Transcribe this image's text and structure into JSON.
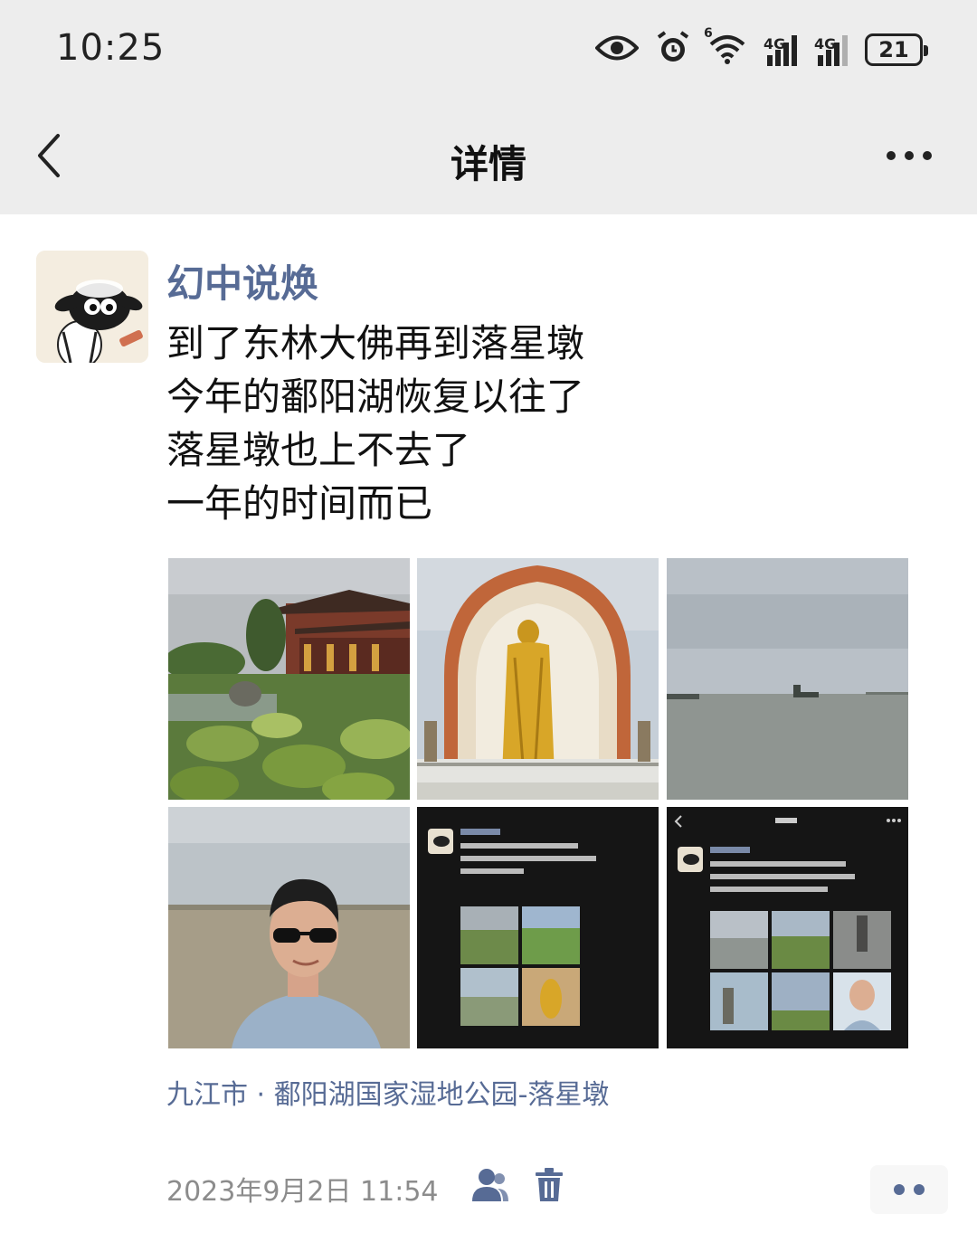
{
  "status_bar": {
    "time": "10:25",
    "icons": [
      "eye-icon",
      "alarm-icon",
      "wifi-icon",
      "signal-icon",
      "signal-icon"
    ],
    "network_1": "4G",
    "network_2": "4G",
    "wifi_label": "6",
    "battery": "21"
  },
  "nav": {
    "back_icon": "chevron-left-icon",
    "title": "详情",
    "more_icon": "more-icon"
  },
  "post": {
    "username": "幻中说焕",
    "lines": [
      "到了东林大佛再到落星墩",
      "今年的鄱阳湖恢复以往了",
      "落星墩也上不去了",
      "一年的时间而已"
    ],
    "photos": [
      "temple-lotus-pond-photo",
      "golden-buddha-statue-photo",
      "lake-horizon-photo",
      "selfie-at-lake-photo",
      "post-screenshot-photo",
      "detail-screenshot-photo"
    ],
    "location": "九江市 · 鄱阳湖国家湿地公园-落星墩",
    "timestamp": "2023年9月2日 11:54"
  },
  "colors": {
    "link": "#576b95",
    "header_bg": "#ededed",
    "muted": "#8c8c8c"
  }
}
